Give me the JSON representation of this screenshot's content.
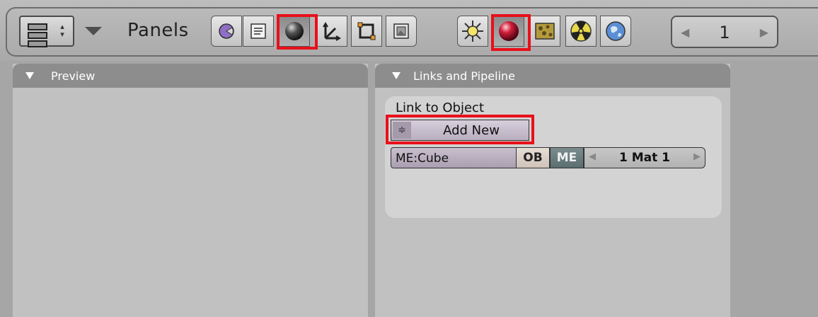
{
  "header": {
    "window_type_icon": "window-type-icon",
    "panels_label": "Panels",
    "context_buttons": [
      {
        "name": "logic-icon",
        "selected": false
      },
      {
        "name": "script-icon",
        "selected": false
      },
      {
        "name": "shading-icon",
        "selected": true
      },
      {
        "name": "object-icon",
        "selected": false
      },
      {
        "name": "editing-icon",
        "selected": false
      },
      {
        "name": "scene-icon",
        "selected": false
      }
    ],
    "shading_subbuttons": [
      {
        "name": "lamp-icon",
        "selected": false
      },
      {
        "name": "material-icon",
        "selected": true
      },
      {
        "name": "texture-icon",
        "selected": false
      },
      {
        "name": "radiosity-icon",
        "selected": false
      },
      {
        "name": "world-icon",
        "selected": false
      }
    ],
    "frame_field": {
      "value": "1",
      "left_arrow": "◀",
      "right_arrow": "▶"
    }
  },
  "preview_panel": {
    "title": "Preview"
  },
  "links_panel": {
    "title": "Links and Pipeline",
    "link_to_object_label": "Link to Object",
    "add_new_spinner": "≑",
    "add_new_label": "Add New",
    "mesh_name": "ME:Cube",
    "ob_label": "OB",
    "me_label": "ME",
    "mat_value": "1 Mat 1",
    "mat_left_arrow": "◀",
    "mat_right_arrow": "▶"
  },
  "colors": {
    "highlight": "#e8101a",
    "panel_header": "#8d8d8d",
    "panel_body": "#c1c1c1",
    "me_button": "#5b6e70",
    "add_new_button": "#b8aebf"
  }
}
